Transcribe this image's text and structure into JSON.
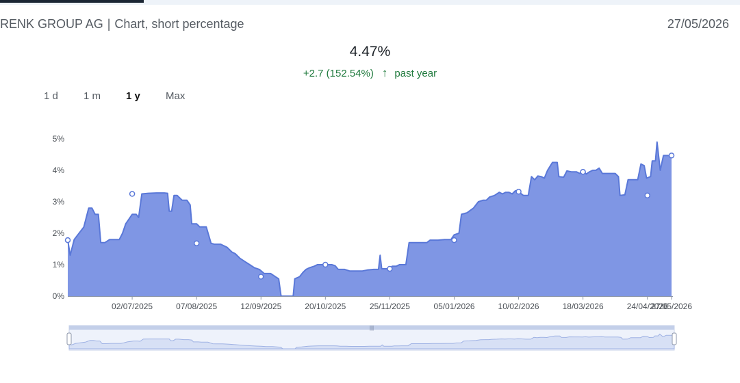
{
  "header": {
    "company": "RENK GROUP AG",
    "chart_name": "Chart, short percentage",
    "date": "27/05/2026"
  },
  "summary": {
    "value": "4.47%",
    "change": "+2.7 (152.54%)",
    "direction_icon": "arrow-up-icon",
    "period": "past year"
  },
  "ranges": [
    {
      "label": "1 d",
      "active": false
    },
    {
      "label": "1 m",
      "active": false
    },
    {
      "label": "1 y",
      "active": true
    },
    {
      "label": "Max",
      "active": false
    }
  ],
  "colors": {
    "line": "#5a78d8",
    "fill": "#7f96e4",
    "positive": "#1f7a3d",
    "navigator": "#d7e0f5"
  },
  "chart_data": {
    "type": "area",
    "y_ticks": [
      "0%",
      "1%",
      "2%",
      "3%",
      "4%",
      "5%"
    ],
    "ylim": [
      0,
      5
    ],
    "x_ticks": [
      "02/07/2025",
      "07/08/2025",
      "12/09/2025",
      "20/10/2025",
      "25/11/2025",
      "05/01/2026",
      "10/02/2026",
      "18/03/2026",
      "24/04/2026",
      "27/05/2026"
    ],
    "series": [
      {
        "values": [
          [
            0,
            1.78
          ],
          [
            0.15,
            1.3
          ],
          [
            0.4,
            1.8
          ],
          [
            1.0,
            2.2
          ],
          [
            1.3,
            2.8
          ],
          [
            1.5,
            2.8
          ],
          [
            1.7,
            2.6
          ],
          [
            1.9,
            2.6
          ],
          [
            2.05,
            1.7
          ],
          [
            2.3,
            1.7
          ],
          [
            2.6,
            1.8
          ],
          [
            3.0,
            1.8
          ],
          [
            3.2,
            1.8
          ],
          [
            3.4,
            2.0
          ],
          [
            3.6,
            2.3
          ],
          [
            4.0,
            2.6
          ],
          [
            4.25,
            2.6
          ],
          [
            4.4,
            2.5
          ],
          [
            4.6,
            3.25
          ],
          [
            5.0,
            3.27
          ],
          [
            5.5,
            3.28
          ],
          [
            6.0,
            3.28
          ],
          [
            6.2,
            3.27
          ],
          [
            6.3,
            2.7
          ],
          [
            6.45,
            2.7
          ],
          [
            6.6,
            3.2
          ],
          [
            6.8,
            3.2
          ],
          [
            7.1,
            3.05
          ],
          [
            7.4,
            3.05
          ],
          [
            7.6,
            2.9
          ],
          [
            7.7,
            2.3
          ],
          [
            8.0,
            2.3
          ],
          [
            8.2,
            2.2
          ],
          [
            8.6,
            2.2
          ],
          [
            8.9,
            1.68
          ],
          [
            9.1,
            1.65
          ],
          [
            9.5,
            1.65
          ],
          [
            9.9,
            1.55
          ],
          [
            10.2,
            1.4
          ],
          [
            10.4,
            1.35
          ],
          [
            10.7,
            1.2
          ],
          [
            11.0,
            1.1
          ],
          [
            11.3,
            1.0
          ],
          [
            11.6,
            0.9
          ],
          [
            11.9,
            0.85
          ],
          [
            12.2,
            0.72
          ],
          [
            12.6,
            0.72
          ],
          [
            12.95,
            0.6
          ],
          [
            13.1,
            0.55
          ],
          [
            13.25,
            0.0
          ],
          [
            14.0,
            0.0
          ],
          [
            14.1,
            0.55
          ],
          [
            14.4,
            0.62
          ],
          [
            14.6,
            0.75
          ],
          [
            14.8,
            0.85
          ],
          [
            15.0,
            0.9
          ],
          [
            15.3,
            0.95
          ],
          [
            15.5,
            1.0
          ],
          [
            16.0,
            1.0
          ],
          [
            16.4,
            1.0
          ],
          [
            16.6,
            0.97
          ],
          [
            16.8,
            0.85
          ],
          [
            17.2,
            0.85
          ],
          [
            17.5,
            0.8
          ],
          [
            18.0,
            0.8
          ],
          [
            18.3,
            0.8
          ],
          [
            18.6,
            0.83
          ],
          [
            19.0,
            0.85
          ],
          [
            19.3,
            0.85
          ],
          [
            19.4,
            1.3
          ],
          [
            19.5,
            0.87
          ],
          [
            20.0,
            0.87
          ],
          [
            20.15,
            0.95
          ],
          [
            20.4,
            0.95
          ],
          [
            20.6,
            1.0
          ],
          [
            21.0,
            1.0
          ],
          [
            21.2,
            1.7
          ],
          [
            22.3,
            1.7
          ],
          [
            22.5,
            1.78
          ],
          [
            23.0,
            1.78
          ],
          [
            23.4,
            1.8
          ],
          [
            23.8,
            1.8
          ],
          [
            24.0,
            1.95
          ],
          [
            24.3,
            2.0
          ],
          [
            24.45,
            2.6
          ],
          [
            24.8,
            2.65
          ],
          [
            25.2,
            2.8
          ],
          [
            25.5,
            3.0
          ],
          [
            25.8,
            3.05
          ],
          [
            26.0,
            3.05
          ],
          [
            26.2,
            3.15
          ],
          [
            26.5,
            3.2
          ],
          [
            26.8,
            3.3
          ],
          [
            27.0,
            3.25
          ],
          [
            27.2,
            3.3
          ],
          [
            27.4,
            3.3
          ],
          [
            27.6,
            3.25
          ],
          [
            27.8,
            3.35
          ],
          [
            28.0,
            3.32
          ],
          [
            28.3,
            3.2
          ],
          [
            28.6,
            3.2
          ],
          [
            28.8,
            3.8
          ],
          [
            29.0,
            3.7
          ],
          [
            29.2,
            3.82
          ],
          [
            29.4,
            3.8
          ],
          [
            29.6,
            3.75
          ],
          [
            29.8,
            4.0
          ],
          [
            30.1,
            4.25
          ],
          [
            30.4,
            4.25
          ],
          [
            30.5,
            3.8
          ],
          [
            30.8,
            3.78
          ],
          [
            31.0,
            3.98
          ],
          [
            31.3,
            3.95
          ],
          [
            31.6,
            3.95
          ],
          [
            31.8,
            3.9
          ],
          [
            32.0,
            4.0
          ],
          [
            32.2,
            3.88
          ],
          [
            32.4,
            3.95
          ],
          [
            32.6,
            4.0
          ],
          [
            32.8,
            4.0
          ],
          [
            33.0,
            4.07
          ],
          [
            33.2,
            3.9
          ],
          [
            33.6,
            3.9
          ],
          [
            34.0,
            3.9
          ],
          [
            34.2,
            3.8
          ],
          [
            34.3,
            3.2
          ],
          [
            34.6,
            3.22
          ],
          [
            34.8,
            3.7
          ],
          [
            35.0,
            3.7
          ],
          [
            35.2,
            3.7
          ],
          [
            35.4,
            3.7
          ],
          [
            35.6,
            4.2
          ],
          [
            35.8,
            4.15
          ],
          [
            35.95,
            3.75
          ],
          [
            36.2,
            3.8
          ],
          [
            36.3,
            4.3
          ],
          [
            36.5,
            4.3
          ],
          [
            36.6,
            4.9
          ],
          [
            36.8,
            4.0
          ],
          [
            37.0,
            4.47
          ],
          [
            37.3,
            4.47
          ],
          [
            37.5,
            4.47
          ]
        ],
        "markers": [
          [
            0,
            1.78
          ],
          [
            4.0,
            3.25
          ],
          [
            8.0,
            1.68
          ],
          [
            12.0,
            0.62
          ],
          [
            16.0,
            1.0
          ],
          [
            20.0,
            0.87
          ],
          [
            24.0,
            1.78
          ],
          [
            28.0,
            3.32
          ],
          [
            32.0,
            3.95
          ],
          [
            36.0,
            3.2
          ],
          [
            37.5,
            4.47
          ]
        ]
      }
    ],
    "grid": false
  }
}
